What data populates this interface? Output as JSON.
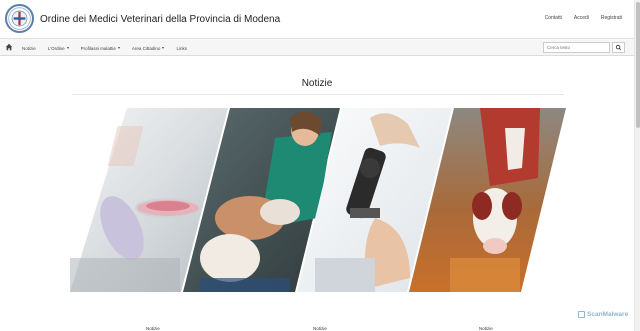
{
  "header": {
    "site_title": "Ordine dei Medici Veterinari della Provincia di Modena",
    "top_links": [
      "Contatti",
      "Accedi",
      "Registrati"
    ]
  },
  "navbar": {
    "items": [
      {
        "label": "Notizie",
        "dropdown": false
      },
      {
        "label": "L'Ordine",
        "dropdown": true
      },
      {
        "label": "Profilassi malattie",
        "dropdown": true
      },
      {
        "label": "Area Cittadino",
        "dropdown": true
      },
      {
        "label": "Links",
        "dropdown": false
      }
    ],
    "search_placeholder": "Cerca testo"
  },
  "main": {
    "section_title": "Notizie",
    "card_labels": [
      "Notizie",
      "Notizie",
      "Notizie"
    ]
  },
  "watermark": "ScanMalware",
  "colors": {
    "navbar_bg": "#f6f6f6",
    "logo_blue": "#5a7fa8"
  }
}
